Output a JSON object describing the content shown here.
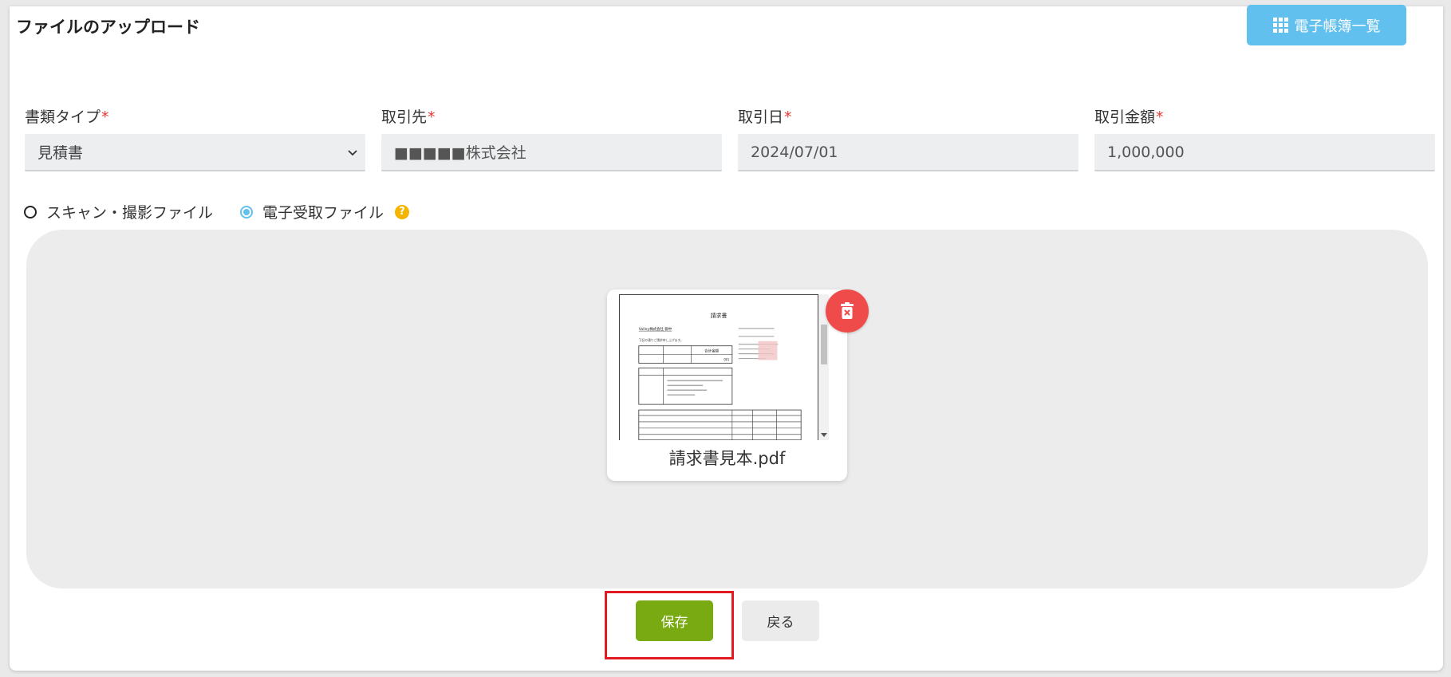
{
  "page": {
    "title": "ファイルのアップロード"
  },
  "header": {
    "list_button_label": "電子帳簿一覧",
    "list_button_icon": "grid-icon"
  },
  "form": {
    "doc_type": {
      "label": "書類タイプ",
      "value": "見積書"
    },
    "partner": {
      "label": "取引先",
      "value": "■■■■■株式会社"
    },
    "date": {
      "label": "取引日",
      "value": "2024/07/01"
    },
    "amount": {
      "label": "取引金額",
      "value": "1,000,000"
    },
    "required_mark": "*"
  },
  "file_type": {
    "options": [
      {
        "label": "スキャン・撮影ファイル",
        "selected": false
      },
      {
        "label": "電子受取ファイル",
        "selected": true
      }
    ],
    "help_mark": "?"
  },
  "upload": {
    "file_name": "請求書見本.pdf",
    "preview_title": "請求書",
    "preview_recipient": "Valley株式会社 御中",
    "preview_intro": "下記の通りご請求申し上げます。",
    "preview_total_label": "合計金額",
    "preview_total_value": "0円"
  },
  "actions": {
    "save_label": "保存",
    "back_label": "戻る"
  },
  "colors": {
    "accent": "#62c0ee",
    "save": "#79aa12",
    "delete": "#ef4b4b",
    "required": "#e53935",
    "highlight": "#e21b23"
  }
}
